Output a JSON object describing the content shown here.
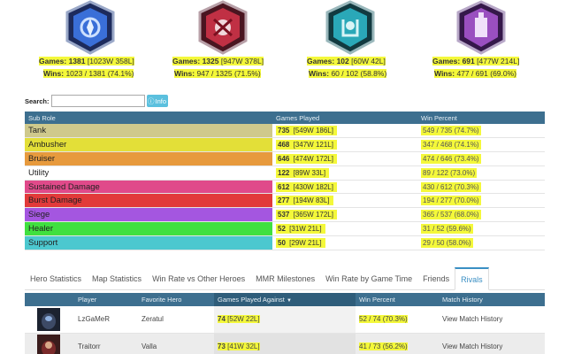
{
  "roles": [
    {
      "emblem": "warrior-emblem-icon",
      "color": "#3a6fd8",
      "games_label": "Games:",
      "games": "1381",
      "games_detail": "[1023W 358L]",
      "wins_label": "Wins:",
      "wins": "1023 / 1381 (74.1%)"
    },
    {
      "emblem": "assassin-emblem-icon",
      "color": "#c03044",
      "games_label": "Games:",
      "games": "1325",
      "games_detail": "[947W 378L]",
      "wins_label": "Wins:",
      "wins": "947 / 1325 (71.5%)"
    },
    {
      "emblem": "support-emblem-icon",
      "color": "#2aa8b8",
      "games_label": "Games:",
      "games": "102",
      "games_detail": "[60W 42L]",
      "wins_label": "Wins:",
      "wins": "60 / 102 (58.8%)"
    },
    {
      "emblem": "specialist-emblem-icon",
      "color": "#9a4fc0",
      "games_label": "Games:",
      "games": "691",
      "games_detail": "[477W 214L]",
      "wins_label": "Wins:",
      "wins": "477 / 691 (69.0%)"
    }
  ],
  "search": {
    "label": "Search:",
    "value": "",
    "info_label": "Info"
  },
  "subroles": {
    "headers": [
      "Sub Role",
      "Games Played",
      "Win Percent"
    ],
    "rows": [
      {
        "name": "Tank",
        "color": "#cfc98c",
        "games": "735",
        "detail": "[549W 186L]",
        "win": "549 / 735 (74.7%)"
      },
      {
        "name": "Ambusher",
        "color": "#e3df38",
        "games": "468",
        "detail": "[347W 121L]",
        "win": "347 / 468 (74.1%)"
      },
      {
        "name": "Bruiser",
        "color": "#e79a3d",
        "games": "646",
        "detail": "[474W 172L]",
        "win": "474 / 646 (73.4%)"
      },
      {
        "name": "Utility",
        "color": "#ffffff",
        "games": "122",
        "detail": "[89W 33L]",
        "win": "89 / 122 (73.0%)"
      },
      {
        "name": "Sustained Damage",
        "color": "#e04a8a",
        "games": "612",
        "detail": "[430W 182L]",
        "win": "430 / 612 (70.3%)"
      },
      {
        "name": "Burst Damage",
        "color": "#e23a3a",
        "games": "277",
        "detail": "[194W 83L]",
        "win": "194 / 277 (70.0%)"
      },
      {
        "name": "Siege",
        "color": "#a456e0",
        "games": "537",
        "detail": "[365W 172L]",
        "win": "365 / 537 (68.0%)"
      },
      {
        "name": "Healer",
        "color": "#40e040",
        "games": "52",
        "detail": "[31W 21L]",
        "win": "31 / 52 (59.6%)"
      },
      {
        "name": "Support",
        "color": "#4cc8cf",
        "games": "50",
        "detail": "[29W 21L]",
        "win": "29 / 50 (58.0%)"
      }
    ]
  },
  "tabs": [
    "Hero Statistics",
    "Map Statistics",
    "Win Rate vs Other Heroes",
    "MMR Milestones",
    "Win Rate by Game Time",
    "Friends",
    "Rivals"
  ],
  "active_tab": "Rivals",
  "rivals": {
    "headers": [
      "",
      "Player",
      "Favorite Hero",
      "Games Played Against",
      "Win Percent",
      "Match History"
    ],
    "sort_indicator": "▼",
    "rows": [
      {
        "player": "LzGaMeR",
        "hero": "Zeratul",
        "games": "74",
        "detail": "[52W 22L]",
        "win": "52 / 74 (70.3%)",
        "history": "View Match History",
        "avatar": "zeratul-portrait-icon"
      },
      {
        "player": "Traitorr",
        "hero": "Valla",
        "games": "73",
        "detail": "[41W 32L]",
        "win": "41 / 73 (56.2%)",
        "history": "View Match History",
        "avatar": "valla-portrait-icon"
      }
    ]
  }
}
